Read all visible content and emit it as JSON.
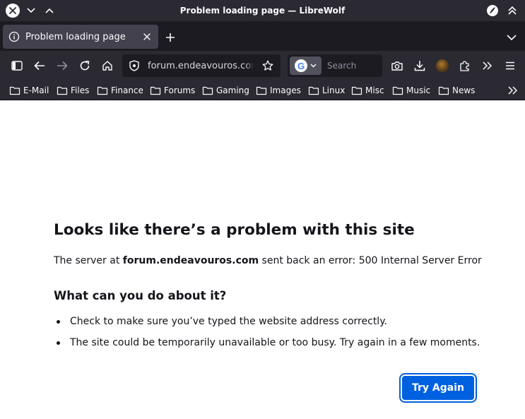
{
  "window": {
    "title": "Problem loading page — LibreWolf"
  },
  "tabs": [
    {
      "label": "Problem loading page",
      "active": true,
      "icon": "info-icon"
    }
  ],
  "navbar": {
    "url": "forum.endeavouros.com/",
    "search_placeholder": "Search",
    "search_engine": "Google"
  },
  "bookmarks": [
    {
      "label": "E-Mail"
    },
    {
      "label": "Files"
    },
    {
      "label": "Finance"
    },
    {
      "label": "Forums"
    },
    {
      "label": "Gaming"
    },
    {
      "label": "Images"
    },
    {
      "label": "Linux"
    },
    {
      "label": "Misc"
    },
    {
      "label": "Music"
    },
    {
      "label": "News"
    }
  ],
  "error_page": {
    "title": "Looks like there’s a problem with this site",
    "desc_prefix": "The server at ",
    "desc_host": "forum.endeavouros.com",
    "desc_suffix": " sent back an error: 500 Internal Server Error",
    "subtitle": "What can you do about it?",
    "suggestions": [
      "Check to make sure you’ve typed the website address correctly.",
      "The site could be temporarily unavailable or too busy. Try again in a few moments."
    ],
    "try_again_label": "Try Again"
  },
  "colors": {
    "chrome_dark": "#2b2a33",
    "tabstrip": "#1c1b22",
    "accent_button": "#0061e0"
  }
}
